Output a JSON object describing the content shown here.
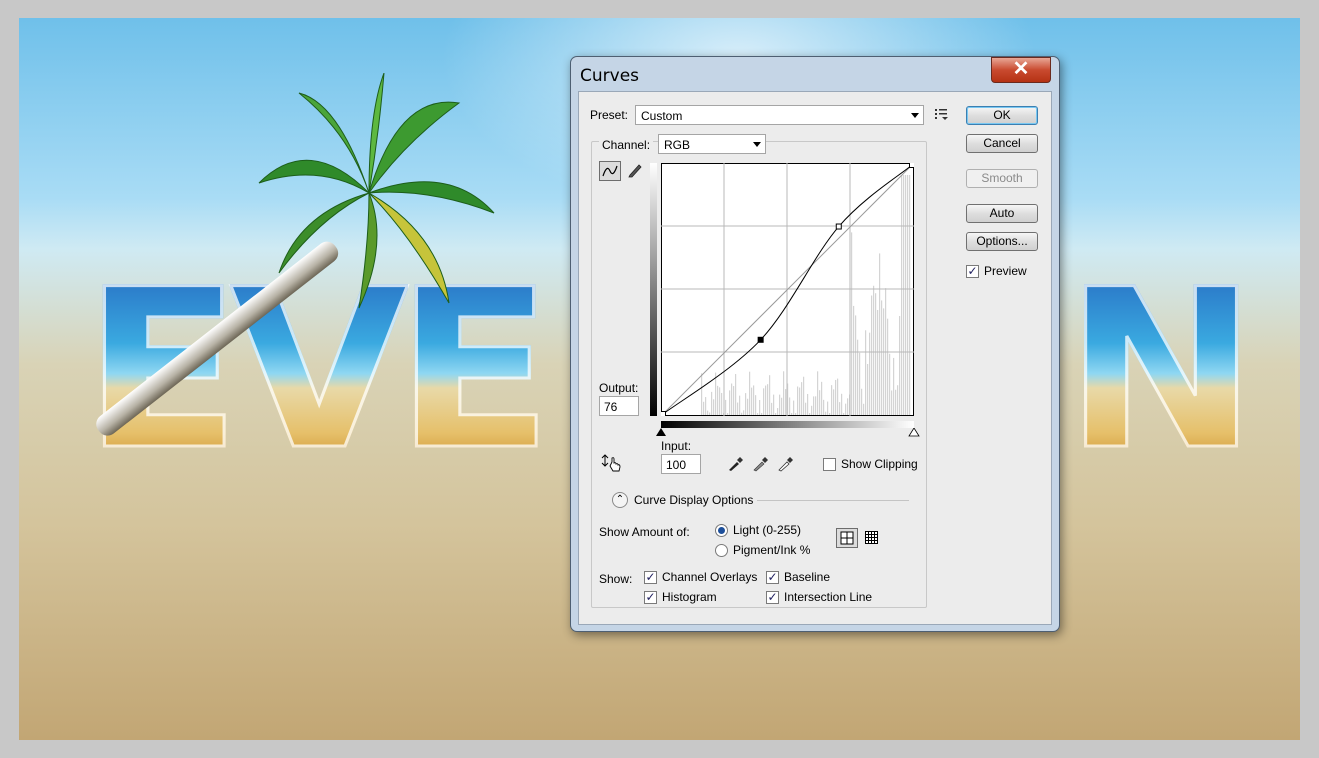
{
  "document": {
    "letters": [
      "E",
      "V",
      "E",
      "N"
    ]
  },
  "dialog": {
    "title": "Curves",
    "close_glyph": "✕",
    "preset": {
      "label": "Preset:",
      "value": "Custom"
    },
    "channel": {
      "label": "Channel:",
      "value": "RGB"
    },
    "buttons": {
      "ok": "OK",
      "cancel": "Cancel",
      "smooth": "Smooth",
      "auto": "Auto",
      "options": "Options..."
    },
    "preview": {
      "label": "Preview",
      "checked": true
    },
    "output": {
      "label": "Output:",
      "value": "76"
    },
    "input": {
      "label": "Input:",
      "value": "100"
    },
    "show_clipping": {
      "label": "Show Clipping",
      "checked": false
    },
    "curve_display_options": "Curve Display Options",
    "show_amount": {
      "label": "Show Amount of:",
      "light": "Light  (0-255)",
      "pigment": "Pigment/Ink %",
      "selected": "light"
    },
    "show": {
      "label": "Show:",
      "channel_overlays": "Channel Overlays",
      "baseline": "Baseline",
      "histogram": "Histogram",
      "intersection_line": "Intersection Line"
    },
    "icons": {
      "preset_menu": "preset-options-icon",
      "curve_tool": "curve-point-tool-icon",
      "pencil_tool": "pencil-tool-icon",
      "on_image": "on-image-adjust-icon",
      "black_eyedropper": "black-point-eyedropper-icon",
      "gray_eyedropper": "gray-point-eyedropper-icon",
      "white_eyedropper": "white-point-eyedropper-icon",
      "simple_grid": "simple-grid-icon",
      "detailed_grid": "detailed-grid-icon"
    }
  },
  "curve": {
    "points": [
      [
        0,
        0
      ],
      [
        100,
        76
      ],
      [
        180,
        192
      ],
      [
        255,
        255
      ]
    ],
    "selected_point": [
      100,
      76
    ]
  }
}
